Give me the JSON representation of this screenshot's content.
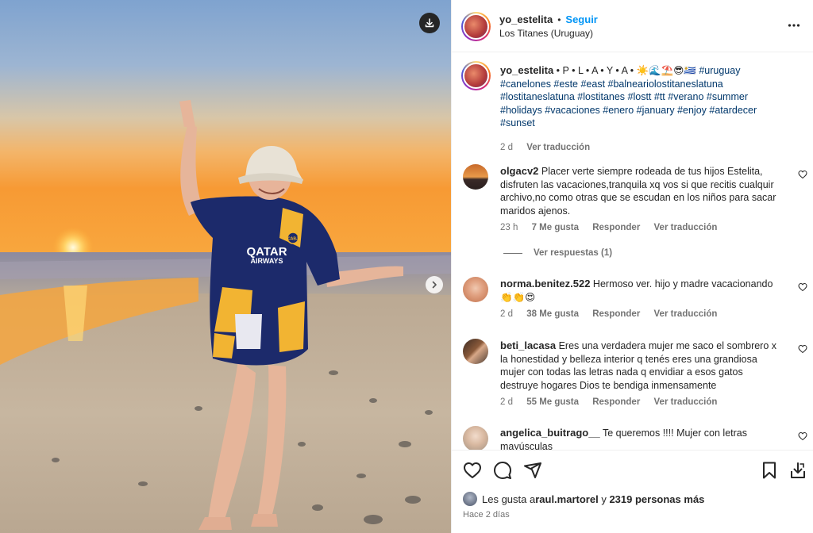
{
  "header": {
    "username": "yo_estelita",
    "dot": "•",
    "follow_label": "Seguir",
    "location": "Los Titanes (Uruguay)"
  },
  "caption": {
    "username": "yo_estelita",
    "text_prefix": " • P • L • A • Y • A • ",
    "emojis": "☀️🌊⛱️😎🇺🇾",
    "hashtags_line1": "#uruguay",
    "hashtags_line2": "#canelones #este #east #balneariolostitaneslatuna",
    "hashtags_line3": "#lostitaneslatuna #lostitanes #lostt #tt #verano #summer",
    "hashtags_line4": "#holidays #vacaciones #enero #january #enjoy #atardecer",
    "hashtags_line5": "#sunset",
    "time": "2 d",
    "translate": "Ver traducción"
  },
  "comments": [
    {
      "username": "olgacv2",
      "text": "Placer verte siempre rodeada de tus hijos Estelita, disfruten las vacaciones,tranquila xq vos si que recitis cualquir archivo,no como otras que se escudan en los niños para sacar maridos ajenos.",
      "time": "23 h",
      "likes": "7 Me gusta",
      "reply": "Responder",
      "translate": "Ver traducción",
      "replies": "Ver respuestas (1)"
    },
    {
      "username": "norma.benitez.522",
      "text": "Hermoso ver. hijo y madre vacacionando 👏👏😍",
      "time": "2 d",
      "likes": "38 Me gusta",
      "reply": "Responder",
      "translate": "Ver traducción"
    },
    {
      "username": "beti_lacasa",
      "text": "Eres una verdadera mujer me saco el sombrero x la honestidad y belleza interior q tenés eres una grandiosa mujer con todas las letras nada q envidiar a esos gatos destruye hogares Dios te bendiga inmensamente",
      "time": "2 d",
      "likes": "55 Me gusta",
      "reply": "Responder",
      "translate": "Ver traducción"
    },
    {
      "username": "angelica_buitrago__",
      "text": "Te queremos !!!! Mujer con letras mayúsculas"
    }
  ],
  "likes": {
    "prefix": "Les gusta a ",
    "user": "raul.martorel",
    "joiner": " y ",
    "others": "2319 personas más"
  },
  "posted": "Hace 2 días",
  "shirt_text": {
    "line1": "QATAR",
    "line2": "AIRWAYS",
    "badge": "CABJ"
  },
  "icons": {
    "download": "download-icon",
    "next": "chevron-right-icon",
    "more": "more-icon",
    "like": "heart-icon",
    "comment": "comment-icon",
    "share": "send-icon",
    "save": "bookmark-icon",
    "save_to": "save-to-computer-icon"
  },
  "colors": {
    "accent": "#0095f6",
    "text": "#262626",
    "muted": "#737373",
    "hashtag": "#00376b"
  }
}
